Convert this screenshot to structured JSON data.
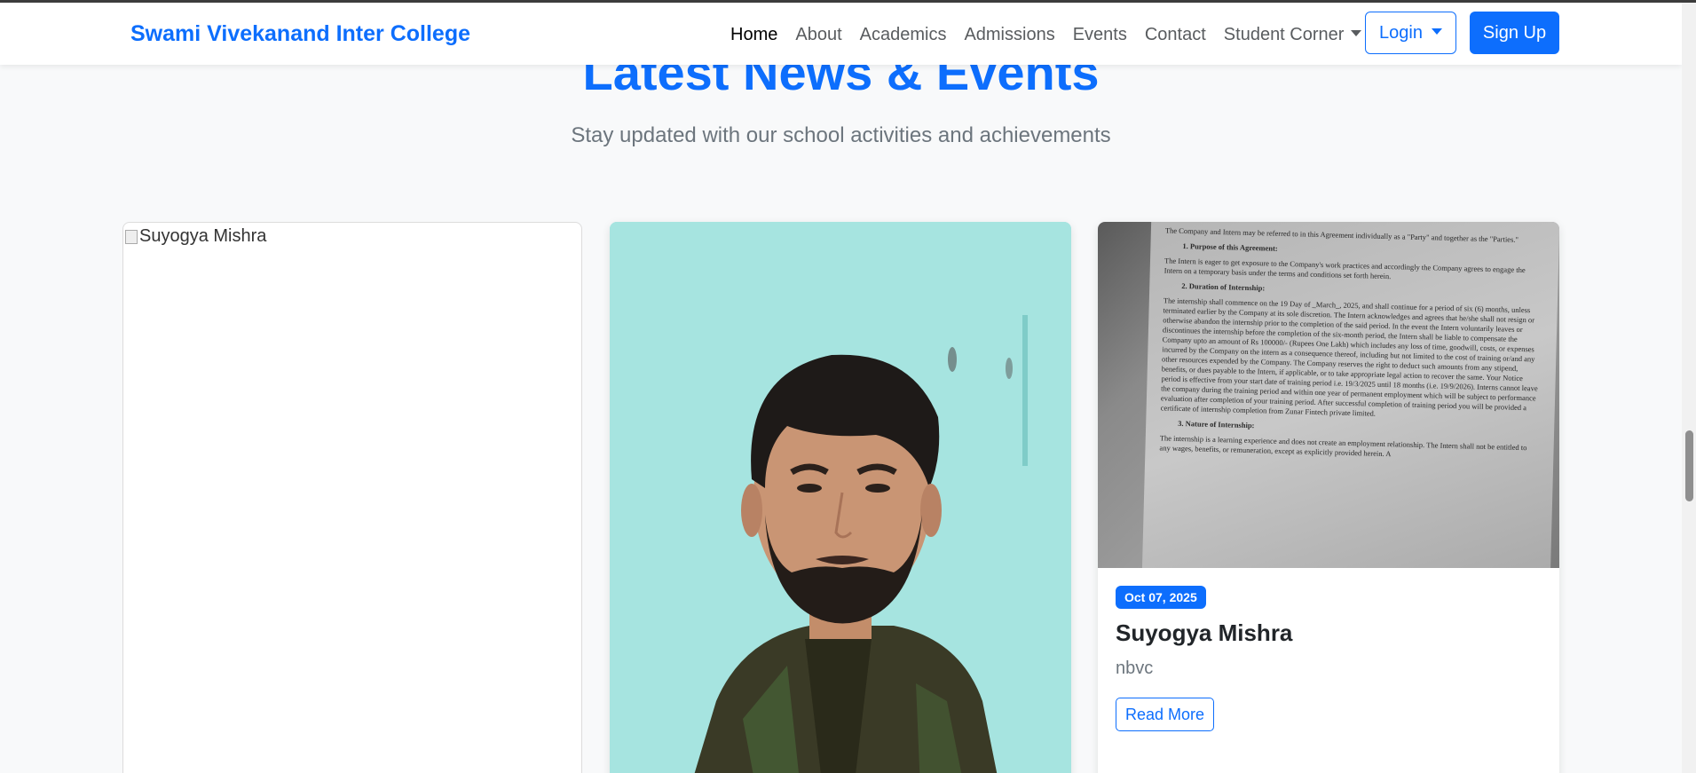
{
  "nav": {
    "brand": "Swami Vivekanand Inter College",
    "links": [
      "Home",
      "About",
      "Academics",
      "Admissions",
      "Events",
      "Contact"
    ],
    "dropdown": "Student Corner",
    "login": "Login",
    "signup": "Sign Up"
  },
  "section": {
    "title": "Latest News & Events",
    "subtitle": "Stay updated with our school activities and achievements"
  },
  "cards": [
    {
      "image_alt": "Suyogya Mishra"
    },
    {
      "image": "portrait-photo"
    },
    {
      "image": "document-photo",
      "doc_lines": [
        "The Company and Intern may be referred to in this Agreement individually as a \"Party\" and together as the \"Parties.\"",
        "1. Purpose of this Agreement:",
        "The Intern is eager to get exposure to the Company's work practices and accordingly the Company agrees to engage the Intern on a temporary basis under the terms and conditions set forth herein.",
        "2. Duration of Internship:",
        "The internship shall commence on the 19 Day of _March_, 2025, and shall continue for a period of six (6) months, unless terminated earlier by the Company at its sole discretion. The Intern acknowledges and agrees that he/she shall not resign or otherwise abandon the internship prior to the completion of the said period. In the event the Intern voluntarily leaves or discontinues the internship before the completion of the six-month period, the Intern shall be liable to compensate the Company upto an amount of Rs 100000/- (Rupees One Lakh) which includes any loss of time, goodwill, costs, or expenses incurred by the Company on the intern as a consequence thereof, including but not limited to the cost of training or/and any other resources expended by the Company. The Company reserves the right to deduct such amounts from any stipend, benefits, or dues payable to the Intern, if applicable, or to take appropriate legal action to recover the same. Your Notice period is effective from your start date of training period i.e. 19/3/2025 until 18 months (i.e. 19/9/2026). Interns cannot leave the company during the training period and within one year of permanent employment which will be subject to performance evaluation after completion of your training period. After successful completion of training period you will be provided a certificate of internship completion from Zunar Fintech private limited.",
        "3. Nature of Internship:",
        "The internship is a learning experience and does not create an employment relationship. The Intern shall not be entitled to any wages, benefits, or remuneration, except as explicitly provided herein. A"
      ],
      "date": "Oct 07, 2025",
      "title": "Suyogya Mishra",
      "text": "nbvc",
      "button": "Read More"
    }
  ]
}
